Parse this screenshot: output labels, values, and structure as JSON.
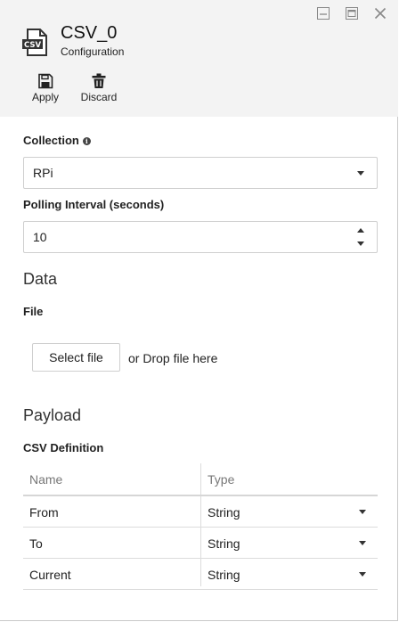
{
  "window": {
    "controls": [
      "minimize-icon",
      "maximize-icon",
      "close-icon"
    ]
  },
  "header": {
    "icon": "csv-file-icon",
    "title": "CSV_0",
    "subtitle": "Configuration",
    "toolbar": {
      "apply_label": "Apply",
      "apply_icon": "save-icon",
      "discard_label": "Discard",
      "discard_icon": "trash-icon"
    }
  },
  "form": {
    "collection": {
      "label": "Collection",
      "info_icon": "info-icon",
      "value": "RPi"
    },
    "polling": {
      "label": "Polling Interval (seconds)",
      "value": "10"
    }
  },
  "data_section": {
    "title": "Data",
    "file_label": "File",
    "select_button": "Select file",
    "drop_text": "or Drop file here"
  },
  "payload_section": {
    "title": "Payload",
    "definition_label": "CSV Definition",
    "columns": [
      "Name",
      "Type"
    ],
    "rows": [
      {
        "name": "From",
        "type": "String"
      },
      {
        "name": "To",
        "type": "String"
      },
      {
        "name": "Current",
        "type": "String"
      }
    ]
  },
  "colors": {
    "header_bg": "#f3f3f3",
    "border": "#cfcfcf",
    "text": "#222222",
    "muted": "#777777"
  }
}
